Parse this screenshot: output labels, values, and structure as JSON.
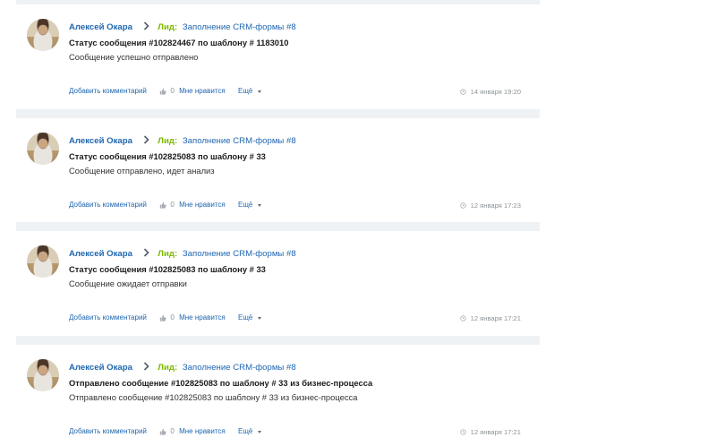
{
  "feed": {
    "posts": [
      {
        "author": "Алексей Окара",
        "lead_prefix": "Лид:",
        "lead_link": "Заполнение CRM-формы #8",
        "title": "Статус сообщения #102824467 по шаблону # 1183010",
        "text": "Сообщение успешно отправлено",
        "comment_label": "Добавить комментарий",
        "like_count": "0",
        "like_label": "Мне нравится",
        "more_label": "Ещё",
        "time": "14 января 19:20"
      },
      {
        "author": "Алексей Окара",
        "lead_prefix": "Лид:",
        "lead_link": "Заполнение CRM-формы #8",
        "title": "Статус сообщения #102825083 по шаблону # 33",
        "text": "Сообщение отправлено, идет анализ",
        "comment_label": "Добавить комментарий",
        "like_count": "0",
        "like_label": "Мне нравится",
        "more_label": "Ещё",
        "time": "12 января 17:23"
      },
      {
        "author": "Алексей Окара",
        "lead_prefix": "Лид:",
        "lead_link": "Заполнение CRM-формы #8",
        "title": "Статус сообщения #102825083 по шаблону # 33",
        "text": "Сообщение ожидает отправки",
        "comment_label": "Добавить комментарий",
        "like_count": "0",
        "like_label": "Мне нравится",
        "more_label": "Ещё",
        "time": "12 января 17:21"
      },
      {
        "author": "Алексей Окара",
        "lead_prefix": "Лид:",
        "lead_link": "Заполнение CRM-формы #8",
        "title": "Отправлено сообщение #102825083 по шаблону # 33 из бизнес-процесса",
        "text": "Отправлено сообщение #102825083 по шаблону # 33 из бизнес-процесса",
        "comment_label": "Добавить комментарий",
        "like_count": "0",
        "like_label": "Мне нравится",
        "more_label": "Ещё",
        "time": "12 января 17:21"
      }
    ]
  },
  "colors": {
    "link": "#2067b0",
    "lead_prefix": "#7cb800",
    "separator": "#eef2f4",
    "muted": "#8c9296"
  },
  "icons": {
    "chevron": "chevron-right-icon",
    "like": "thumbs-up-icon",
    "more": "caret-down-icon",
    "time": "clock-icon",
    "avatar": "user-avatar"
  }
}
